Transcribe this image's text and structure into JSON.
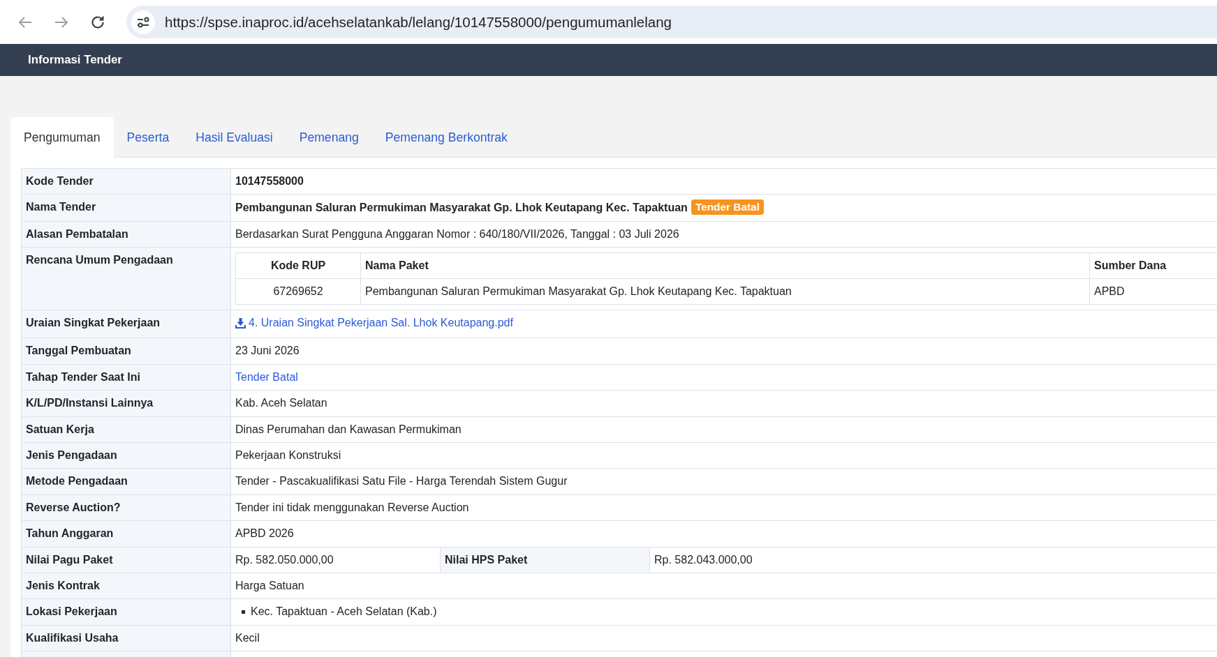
{
  "browser": {
    "url": "https://spse.inaproc.id/acehselatankab/lelang/10147558000/pengumumanlelang"
  },
  "header": {
    "title": "Informasi Tender"
  },
  "tabs": [
    {
      "label": "Pengumuman",
      "selected": true
    },
    {
      "label": "Peserta",
      "selected": false
    },
    {
      "label": "Hasil Evaluasi",
      "selected": false
    },
    {
      "label": "Pemenang",
      "selected": false
    },
    {
      "label": "Pemenang Berkontrak",
      "selected": false
    }
  ],
  "details": {
    "rows": [
      {
        "kind": "strong",
        "label": "Kode Tender",
        "value": "10147558000"
      },
      {
        "kind": "title",
        "label": "Nama Tender",
        "value": "Pembangunan Saluran Permukiman Masyarakat Gp. Lhok Keutapang Kec. Tapaktuan",
        "badge": "Tender Batal"
      },
      {
        "kind": "text",
        "label": "Alasan Pembatalan",
        "value": "Berdasarkan Surat Pengguna Anggaran Nomor : 640/180/VII/2026, Tanggal : 03 Juli 2026"
      },
      {
        "kind": "rup",
        "label": "Rencana Umum Pengadaan",
        "table": {
          "columns": [
            "Kode RUP",
            "Nama Paket",
            "Sumber Dana"
          ],
          "rows": [
            [
              "67269652",
              "Pembangunan Saluran Permukiman Masyarakat Gp. Lhok Keutapang Kec. Tapaktuan",
              "APBD"
            ]
          ]
        }
      },
      {
        "kind": "file",
        "label": "Uraian Singkat Pekerjaan",
        "value": "4. Uraian Singkat Pekerjaan Sal. Lhok Keutapang.pdf"
      },
      {
        "kind": "text",
        "label": "Tanggal Pembuatan",
        "value": "23 Juni 2026"
      },
      {
        "kind": "link",
        "label": "Tahap Tender Saat Ini",
        "value": "Tender Batal"
      },
      {
        "kind": "text",
        "label": "K/L/PD/Instansi Lainnya",
        "value": "Kab. Aceh Selatan"
      },
      {
        "kind": "text",
        "label": "Satuan Kerja",
        "value": "Dinas Perumahan dan Kawasan Permukiman"
      },
      {
        "kind": "text",
        "label": "Jenis Pengadaan",
        "value": "Pekerjaan Konstruksi"
      },
      {
        "kind": "text",
        "label": "Metode Pengadaan",
        "value": "Tender - Pascakualifikasi Satu File - Harga Terendah Sistem Gugur"
      },
      {
        "kind": "text",
        "label": "Reverse Auction?",
        "value": "Tender ini tidak menggunakan Reverse Auction"
      },
      {
        "kind": "text",
        "label": "Tahun Anggaran",
        "value": "APBD 2026"
      },
      {
        "kind": "pair",
        "label": "Nilai Pagu Paket",
        "value": "Rp. 582.050.000,00",
        "label_2": "Nilai HPS Paket",
        "value_2": "Rp. 582.043.000,00"
      },
      {
        "kind": "text",
        "label": "Jenis Kontrak",
        "value": "Harga Satuan"
      },
      {
        "kind": "list",
        "label": "Lokasi Pekerjaan",
        "items": [
          "Kec. Tapaktuan - Aceh Selatan (Kab.)"
        ]
      },
      {
        "kind": "text",
        "label": "Kualifikasi Usaha",
        "value": "Kecil"
      }
    ]
  }
}
